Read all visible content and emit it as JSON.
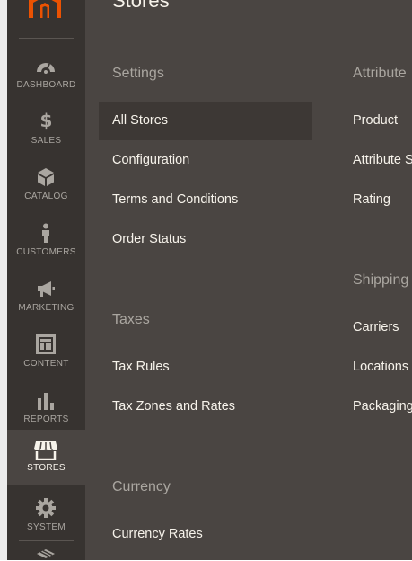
{
  "sidebar": {
    "items": [
      {
        "label": "DASHBOARD",
        "icon": "gauge-icon"
      },
      {
        "label": "SALES",
        "icon": "dollar-icon"
      },
      {
        "label": "CATALOG",
        "icon": "box-icon"
      },
      {
        "label": "CUSTOMERS",
        "icon": "person-icon"
      },
      {
        "label": "MARKETING",
        "icon": "megaphone-icon"
      },
      {
        "label": "CONTENT",
        "icon": "layout-icon"
      },
      {
        "label": "REPORTS",
        "icon": "bar-chart-icon"
      },
      {
        "label": "STORES",
        "icon": "storefront-icon"
      },
      {
        "label": "SYSTEM",
        "icon": "gear-icon"
      }
    ],
    "active": "STORES"
  },
  "panel": {
    "title": "Stores",
    "sections": {
      "settings": {
        "title": "Settings",
        "links": [
          "All Stores",
          "Configuration",
          "Terms and Conditions",
          "Order Status"
        ]
      },
      "taxes": {
        "title": "Taxes",
        "links": [
          "Tax Rules",
          "Tax Zones and Rates"
        ]
      },
      "currency": {
        "title": "Currency",
        "links": [
          "Currency Rates"
        ]
      },
      "attributes": {
        "title": "Attribute",
        "links": [
          "Product",
          "Attribute S",
          "Rating"
        ]
      },
      "shipping": {
        "title": "Shipping",
        "links": [
          "Carriers",
          "Locations",
          "Packaging"
        ]
      }
    },
    "selected_link": "All Stores"
  },
  "colors": {
    "sidebar_bg": "#373330",
    "panel_bg": "#4a4542",
    "active_item_bg": "#3d3835",
    "logo_orange": "#eb5202",
    "section_title": "#aaa6a0",
    "link_text": "#f7f3eb"
  }
}
